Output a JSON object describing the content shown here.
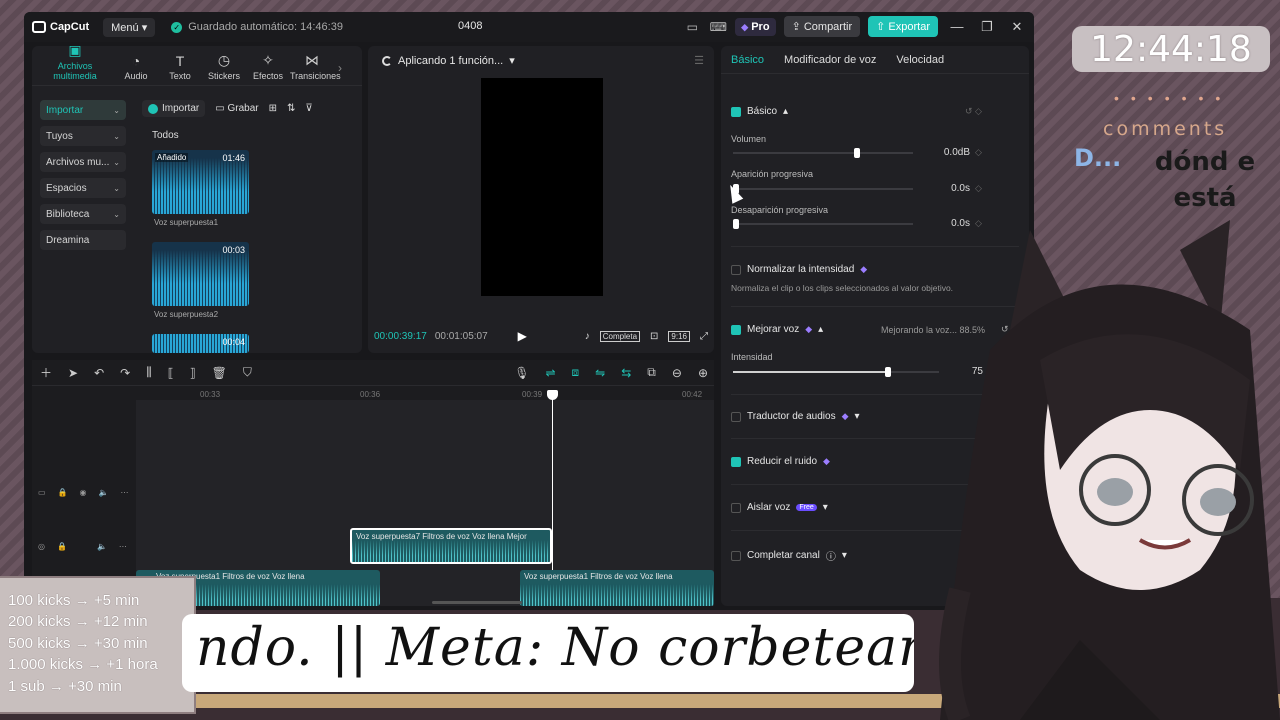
{
  "titlebar": {
    "app_name": "CapCut",
    "menu_label": "Menú",
    "autosave": "Guardado automático: 14:46:39",
    "project_name": "0408",
    "pro_label": "Pro",
    "share_label": "Compartir",
    "export_label": "Exportar"
  },
  "media": {
    "tabs": [
      {
        "label": "Archivos multimedia",
        "icon": "media-icon"
      },
      {
        "label": "Audio",
        "icon": "audio-icon"
      },
      {
        "label": "Texto",
        "icon": "text-icon"
      },
      {
        "label": "Stickers",
        "icon": "sticker-icon"
      },
      {
        "label": "Efectos",
        "icon": "effects-icon"
      },
      {
        "label": "Transiciones",
        "icon": "transitions-icon"
      }
    ],
    "nav": [
      "Importar",
      "Tuyos",
      "Archivos mu...",
      "Espacios",
      "Biblioteca",
      "Dreamina"
    ],
    "import_btn": "Importar",
    "record_btn": "Grabar",
    "all_label": "Todos",
    "items": [
      {
        "name": "Voz superpuesta1",
        "duration": "01:46",
        "badge": "Añadido"
      },
      {
        "name": "Voz superpuesta2",
        "duration": "00:03",
        "badge": ""
      },
      {
        "name": "",
        "duration": "00:04",
        "badge": ""
      }
    ]
  },
  "player": {
    "status": "Aplicando 1 función...",
    "current_time": "00:00:39:17",
    "total_time": "00:01:05:07",
    "quality": "Completa",
    "ratio": "9:16"
  },
  "props": {
    "tabs": [
      "Básico",
      "Modificador de voz",
      "Velocidad"
    ],
    "basic_label": "Básico",
    "volume_label": "Volumen",
    "volume_value": "0.0dB",
    "volume_level": 0.69,
    "fadein_label": "Aparición progresiva",
    "fadein_value": "0.0s",
    "fadeout_label": "Desaparición progresiva",
    "fadeout_value": "0.0s",
    "normalize_label": "Normalizar la intensidad",
    "normalize_desc": "Normaliza el clip o los clips seleccionados al valor objetivo.",
    "enhance_label": "Mejorar voz",
    "enhance_status": "Mejorando la voz... 88.5%",
    "intensity_label": "Intensidad",
    "intensity_value": "75",
    "intensity_level": 0.75,
    "translate_label": "Traductor de audios",
    "denoise_label": "Reducir el ruido",
    "isolate_label": "Aislar voz",
    "free_badge": "Free",
    "complete_label": "Completar canal"
  },
  "timeline": {
    "ruler": [
      "00:33",
      "00:36",
      "00:39",
      "00:42"
    ],
    "clips": [
      {
        "label": "Voz superpuesta7   Filtros de voz Voz llena   Mejor",
        "selected": true
      },
      {
        "label": "Voz superpuesta1   Filtros de voz Voz llena",
        "selected": false
      },
      {
        "label": "Voz superpuesta1   Filtros de voz Voz llena",
        "selected": false
      }
    ]
  },
  "overlay": {
    "clock": "12:44:18",
    "comments_title": "comments",
    "chat_user": "D...",
    "chat_message": "dónd e está",
    "goals": [
      "100 kicks → +5 min",
      "200 kicks → +12 min",
      "500 kicks → +30 min",
      "1.000 kicks → +1 hora",
      "1 sub → +30 min"
    ],
    "marquee": "ndo. || Meta: No corbetearm"
  },
  "colors": {
    "accent": "#1fc4b6",
    "pro_purple": "#9b7dff"
  }
}
